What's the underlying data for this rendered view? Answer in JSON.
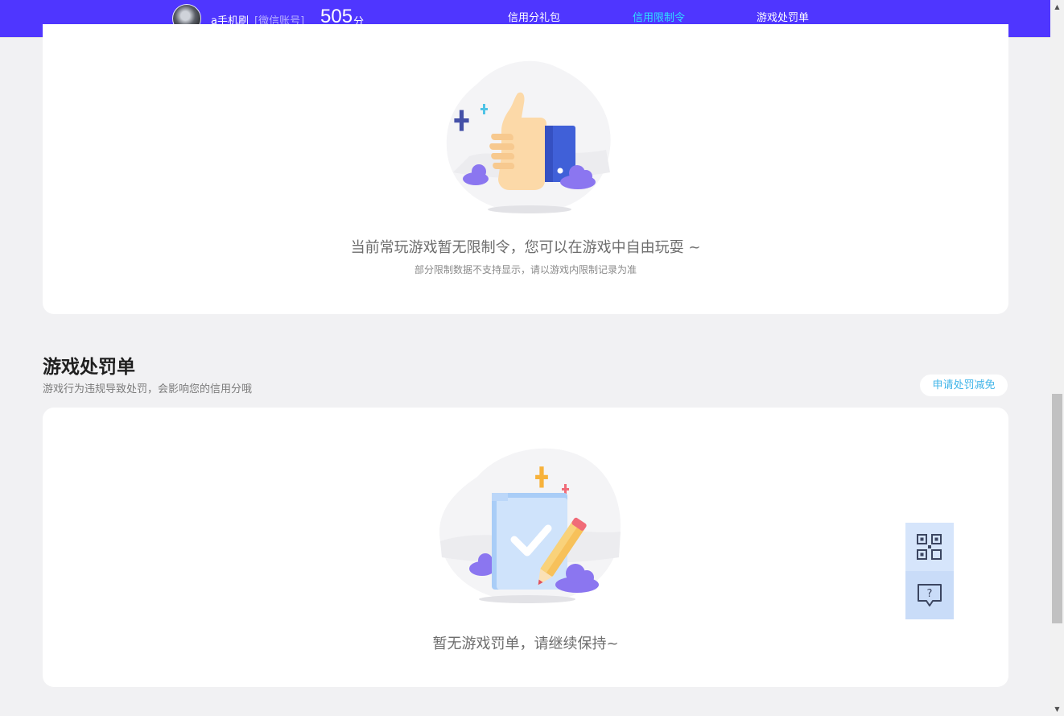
{
  "header": {
    "username": "a手机刷",
    "account_tag": "[微信账号]",
    "score": "505",
    "score_unit": "分",
    "tabs": [
      {
        "label": "信用分礼包",
        "active": false
      },
      {
        "label": "信用限制令",
        "active": true
      },
      {
        "label": "游戏处罚单",
        "active": false
      }
    ],
    "colors": {
      "bar": "#4f36ff",
      "active_tab": "#2fe0ff"
    }
  },
  "restriction_card": {
    "empty_title": "当前常玩游戏暂无限制令，您可以在游戏中自由玩耍 ~",
    "empty_note": "部分限制数据不支持显示，请以游戏内限制记录为准",
    "illustration_icon": "thumbs-up-icon"
  },
  "penalty_section": {
    "title": "游戏处罚单",
    "description": "游戏行为违规导致处罚，会影响您的信用分哦",
    "appeal_button": "申请处罚减免",
    "empty_title": "暂无游戏罚单，请继续保持~",
    "illustration_icon": "checklist-pencil-icon"
  },
  "floating": {
    "qr_icon": "qr-code-icon",
    "help_icon": "help-chat-icon"
  }
}
